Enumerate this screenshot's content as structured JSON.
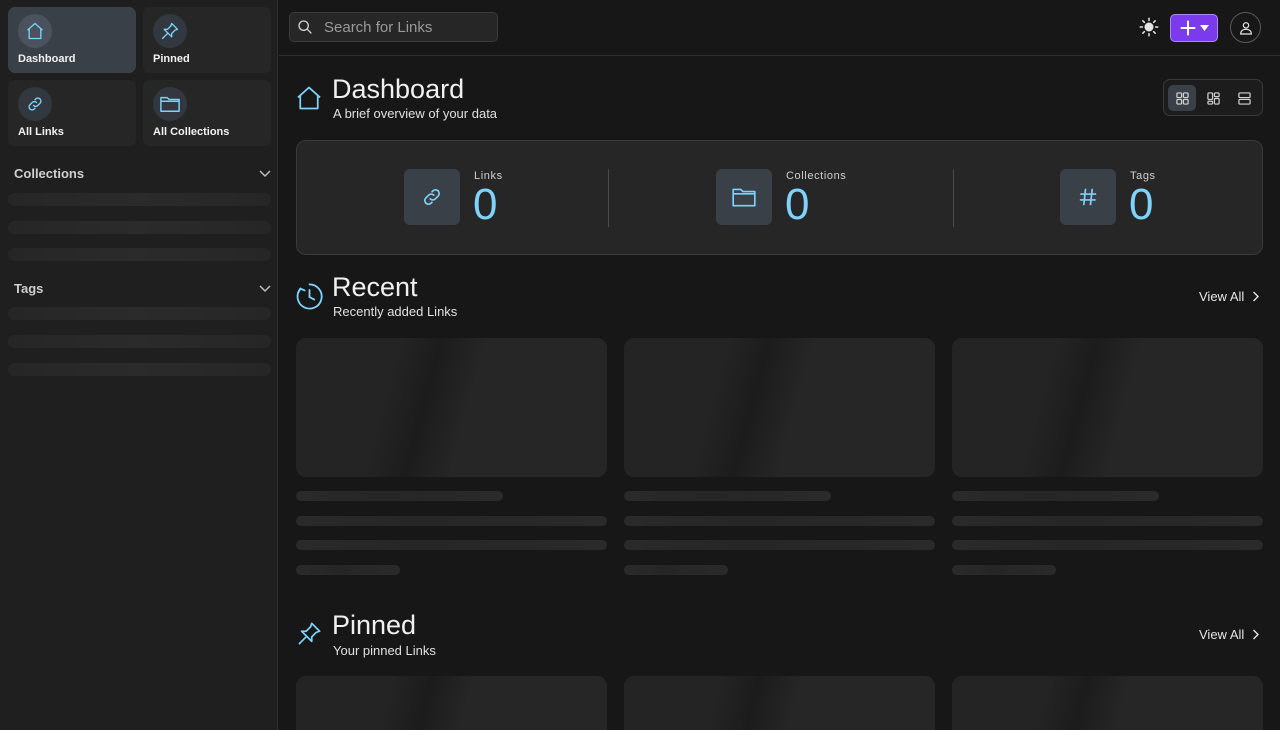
{
  "sidebar": {
    "tiles": [
      {
        "label": "Dashboard",
        "icon": "home-icon",
        "active": true
      },
      {
        "label": "Pinned",
        "icon": "pin-icon",
        "active": false
      },
      {
        "label": "All Links",
        "icon": "link-icon",
        "active": false
      },
      {
        "label": "All Collections",
        "icon": "folder-icon",
        "active": false
      }
    ],
    "collections_label": "Collections",
    "tags_label": "Tags"
  },
  "topbar": {
    "search_placeholder": "Search for Links",
    "theme_icon": "sun-icon",
    "add_icon": "plus-icon",
    "account_icon": "user-icon"
  },
  "dashboard": {
    "title": "Dashboard",
    "subtitle": "A brief overview of your data",
    "view_modes": [
      "grid-icon",
      "masonry-icon",
      "list-icon"
    ],
    "stats": [
      {
        "label": "Links",
        "value": "0",
        "icon": "link-icon"
      },
      {
        "label": "Collections",
        "value": "0",
        "icon": "folder-icon"
      },
      {
        "label": "Tags",
        "value": "0",
        "icon": "hash-icon"
      }
    ]
  },
  "recent": {
    "title": "Recent",
    "subtitle": "Recently added Links",
    "view_all": "View All"
  },
  "pinned": {
    "title": "Pinned",
    "subtitle": "Your pinned Links",
    "view_all": "View All"
  },
  "colors": {
    "accent": "#7c3aed",
    "stat_value": "#7dd3fc",
    "icon_blue": "#7dd3fc"
  }
}
